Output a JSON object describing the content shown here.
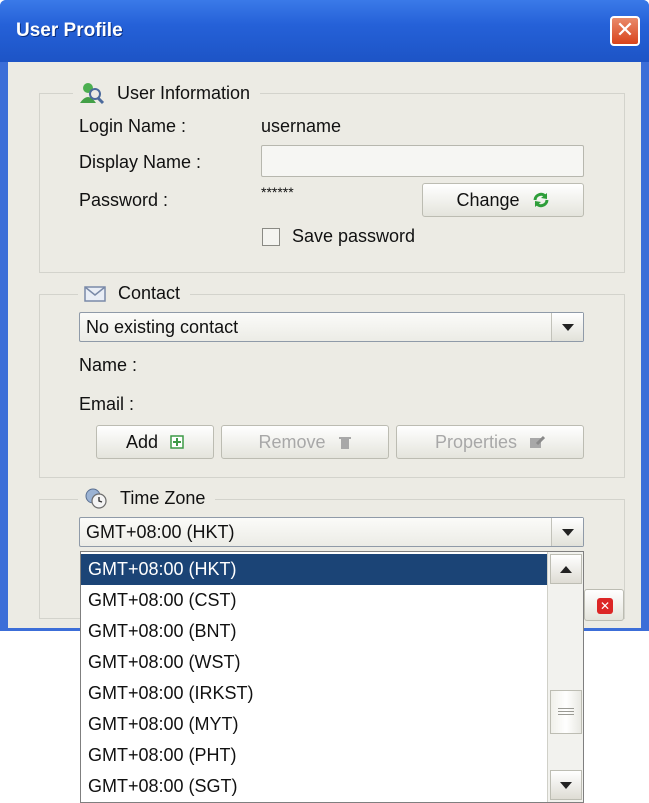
{
  "window": {
    "title": "User Profile",
    "close_glyph": "✕"
  },
  "user_info": {
    "legend": "User Information",
    "icon": "user-icon",
    "login_label": "Login Name :",
    "login_value": "username",
    "display_label": "Display Name :",
    "display_value": "",
    "password_label": "Password :",
    "password_value": "******",
    "change_button": "Change",
    "save_password_label": "Save password",
    "save_password_checked": false
  },
  "contact": {
    "legend": "Contact",
    "icon": "envelope-icon",
    "selected": "No existing contact",
    "name_label": "Name :",
    "email_label": "Email :",
    "add_button": "Add",
    "remove_button": "Remove",
    "properties_button": "Properties"
  },
  "timezone": {
    "legend": "Time Zone",
    "icon": "clock-globe-icon",
    "selected": "GMT+08:00 (HKT)",
    "options": [
      "GMT+08:00 (HKT)",
      "GMT+08:00 (CST)",
      "GMT+08:00 (BNT)",
      "GMT+08:00 (WST)",
      "GMT+08:00 (IRKST)",
      "GMT+08:00 (MYT)",
      "GMT+08:00 (PHT)",
      "GMT+08:00 (SGT)"
    ],
    "highlighted_index": 0
  },
  "colors": {
    "titlebar": "#2561d8",
    "selection": "#1b4476",
    "dialog_bg": "#ecebe4"
  }
}
